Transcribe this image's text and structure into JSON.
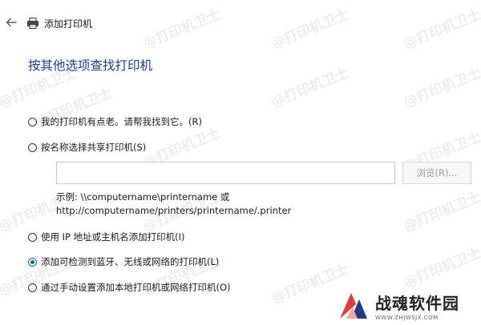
{
  "window": {
    "title": "添加打印机"
  },
  "watermark": "@打印机卫士",
  "heading": "按其他选项查找打印机",
  "options": [
    {
      "label": "我的打印机有点老。请帮我找到它。(R)",
      "selected": false
    },
    {
      "label": "按名称选择共享打印机(S)",
      "selected": false
    },
    {
      "label": "使用 IP 地址或主机名添加打印机(I)",
      "selected": false
    },
    {
      "label": "添加可检测到蓝牙、无线或网络的打印机(L)",
      "selected": true
    },
    {
      "label": "通过手动设置添加本地打印机或网络打印机(O)",
      "selected": false
    }
  ],
  "shared_printer": {
    "input_value": "",
    "browse_label": "浏览(R)...",
    "example_line1": "示例: \\\\computername\\printername 或",
    "example_line2": "http://computername/printers/printername/.printer"
  },
  "logo": {
    "title": "战魂软件园",
    "url": "WWW.ZHJWSJX.COM"
  },
  "colors": {
    "heading": "#1c3f94",
    "accent": "#0067c0",
    "logo_red": "#e53935",
    "logo_blue": "#1e3a8a"
  },
  "icons": {
    "back": "back-arrow-icon",
    "printer": "printer-icon"
  }
}
